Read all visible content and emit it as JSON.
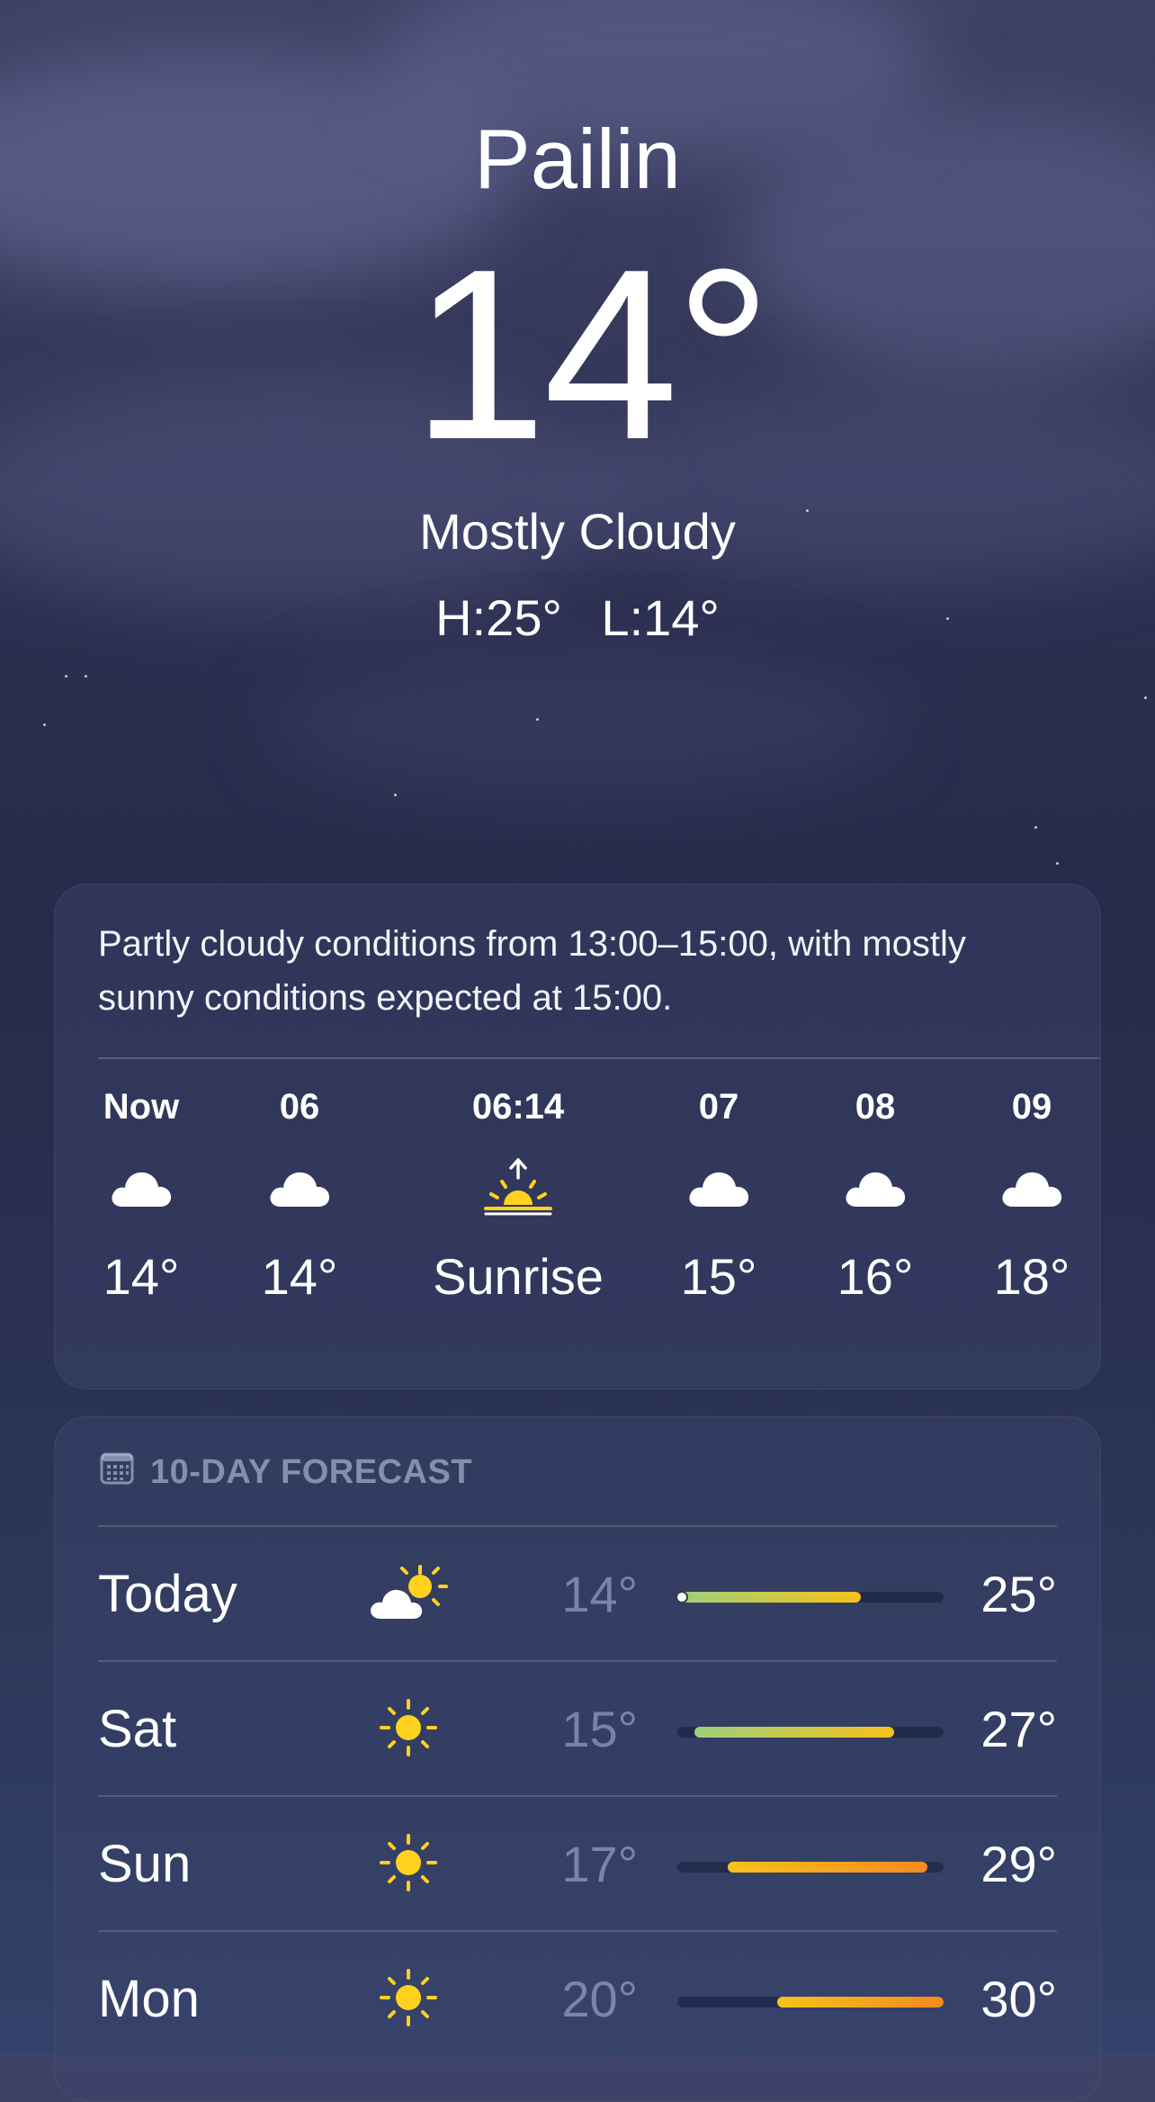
{
  "location": {
    "city": "Pailin",
    "temperature": "14°",
    "condition": "Mostly Cloudy",
    "high": "H:25°",
    "low": "L:14°"
  },
  "hourly": {
    "summary": "Partly cloudy conditions from 13:00–15:00, with mostly sunny conditions expected at 15:00.",
    "items": [
      {
        "time": "Now",
        "icon": "cloud-icon",
        "value": "14°"
      },
      {
        "time": "06",
        "icon": "cloud-icon",
        "value": "14°"
      },
      {
        "time": "06:14",
        "icon": "sunrise-icon",
        "value": "Sunrise"
      },
      {
        "time": "07",
        "icon": "cloud-icon",
        "value": "15°"
      },
      {
        "time": "08",
        "icon": "cloud-icon",
        "value": "16°"
      },
      {
        "time": "09",
        "icon": "cloud-icon",
        "value": "18°"
      }
    ]
  },
  "forecast": {
    "header": "10-DAY FORECAST",
    "header_icon": "calendar-icon",
    "days": [
      {
        "day": "Today",
        "icon": "partly-cloudy-sun-icon",
        "low": "14°",
        "high": "25°",
        "low_value": 14,
        "high_value": 25,
        "current_value": 14
      },
      {
        "day": "Sat",
        "icon": "sun-icon",
        "low": "15°",
        "high": "27°",
        "low_value": 15,
        "high_value": 27
      },
      {
        "day": "Sun",
        "icon": "sun-icon",
        "low": "17°",
        "high": "29°",
        "low_value": 17,
        "high_value": 29
      },
      {
        "day": "Mon",
        "icon": "sun-icon",
        "low": "20°",
        "high": "30°",
        "low_value": 20,
        "high_value": 30
      }
    ],
    "range_min": 14,
    "range_max": 30
  },
  "colors": {
    "sun": "#ffd21f",
    "cool": "#9dcf7c",
    "warm": "#f7c21a",
    "hot": "#f58a1f"
  }
}
